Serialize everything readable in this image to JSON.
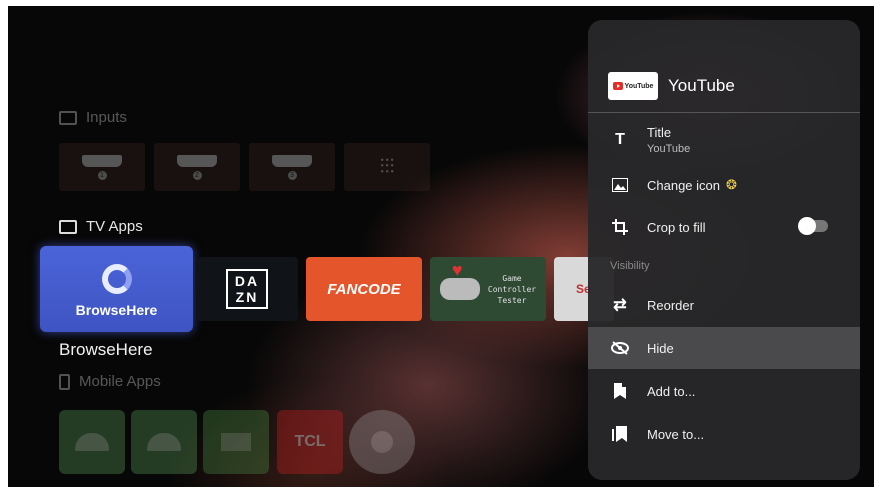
{
  "home": {
    "inputs_label": "Inputs",
    "inputs": [
      {
        "icon": "hdmi-icon",
        "number": "1"
      },
      {
        "icon": "hdmi-icon",
        "number": "2"
      },
      {
        "icon": "hdmi-icon",
        "number": "3"
      },
      {
        "icon": "settings-sliders-icon",
        "number": ""
      }
    ],
    "tv_apps_label": "TV Apps",
    "apps": [
      {
        "name": "BrowseHere",
        "icon": "browsehere-logo"
      },
      {
        "name": "DAZN",
        "logo_text_top": "DA",
        "logo_text_bottom": "ZN"
      },
      {
        "name": "FANCODE"
      },
      {
        "name": "Game Controller Tester",
        "text": "Game\nController\nTester"
      },
      {
        "name": "Speedtest",
        "text": "Se"
      }
    ],
    "selected_app_name": "BrowseHere",
    "mobile_apps_label": "Mobile Apps",
    "mobile_apps": [
      {
        "icon": "android-icon"
      },
      {
        "icon": "android-icon"
      },
      {
        "icon": "generic-app-icon"
      },
      {
        "icon": "tcl-home-icon",
        "text": "TCL"
      },
      {
        "icon": "account-icon"
      }
    ]
  },
  "panel": {
    "app_title": "YouTube",
    "logo_text": "YouTube",
    "items": [
      {
        "label": "Title",
        "sub": "YouTube",
        "icon": "title-text-icon"
      },
      {
        "label": "Change icon",
        "icon": "image-icon",
        "badge": "premium-badge-icon"
      },
      {
        "label": "Crop to fill",
        "icon": "crop-icon",
        "toggle": false
      }
    ],
    "visibility_label": "Visibility",
    "actions": [
      {
        "label": "Reorder",
        "icon": "reorder-arrows-icon"
      },
      {
        "label": "Hide",
        "icon": "eye-off-icon",
        "highlighted": true
      },
      {
        "label": "Add to...",
        "icon": "bookmark-add-icon"
      },
      {
        "label": "Move to...",
        "icon": "bookmark-move-icon"
      }
    ]
  },
  "colors": {
    "panel_bg": "#28282a",
    "highlight": "#4a4a4c",
    "selected_tile": "#4a64d8",
    "fancode": "#e5552c"
  }
}
